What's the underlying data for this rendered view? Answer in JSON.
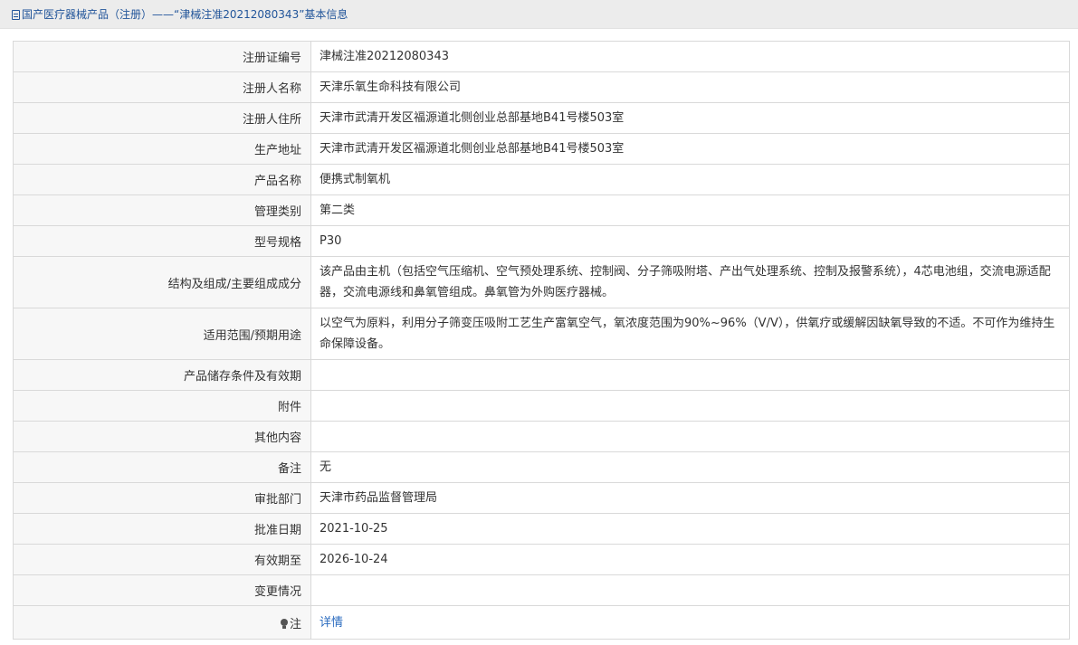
{
  "header": {
    "icon": "document-icon",
    "title": "国产医疗器械产品（注册）——“津械注准20212080343”基本信息"
  },
  "rows": [
    {
      "label": "注册证编号",
      "value": "津械注准20212080343"
    },
    {
      "label": "注册人名称",
      "value": "天津乐氧生命科技有限公司"
    },
    {
      "label": "注册人住所",
      "value": "天津市武清开发区福源道北侧创业总部基地B41号楼503室"
    },
    {
      "label": "生产地址",
      "value": "天津市武清开发区福源道北侧创业总部基地B41号楼503室"
    },
    {
      "label": "产品名称",
      "value": "便携式制氧机"
    },
    {
      "label": "管理类别",
      "value": "第二类"
    },
    {
      "label": "型号规格",
      "value": "P30"
    },
    {
      "label": "结构及组成/主要组成成分",
      "value": "该产品由主机（包括空气压缩机、空气预处理系统、控制阀、分子筛吸附塔、产出气处理系统、控制及报警系统），4芯电池组，交流电源适配器，交流电源线和鼻氧管组成。鼻氧管为外购医疗器械。"
    },
    {
      "label": "适用范围/预期用途",
      "value": "以空气为原料，利用分子筛变压吸附工艺生产富氧空气，氧浓度范围为90%~96%（V/V），供氧疗或缓解因缺氧导致的不适。不可作为维持生命保障设备。"
    },
    {
      "label": "产品储存条件及有效期",
      "value": ""
    },
    {
      "label": "附件",
      "value": ""
    },
    {
      "label": "其他内容",
      "value": ""
    },
    {
      "label": "备注",
      "value": "无"
    },
    {
      "label": "审批部门",
      "value": "天津市药品监督管理局"
    },
    {
      "label": "批准日期",
      "value": "2021-10-25"
    },
    {
      "label": "有效期至",
      "value": "2026-10-24"
    },
    {
      "label": "变更情况",
      "value": ""
    }
  ],
  "note": {
    "icon": "lightbulb-icon",
    "label": "注",
    "link_text": "详情"
  },
  "colors": {
    "title_text": "#22559a",
    "link": "#2a6bbf",
    "label_bg": "#f7f7f7",
    "border": "#d9d9d9"
  }
}
